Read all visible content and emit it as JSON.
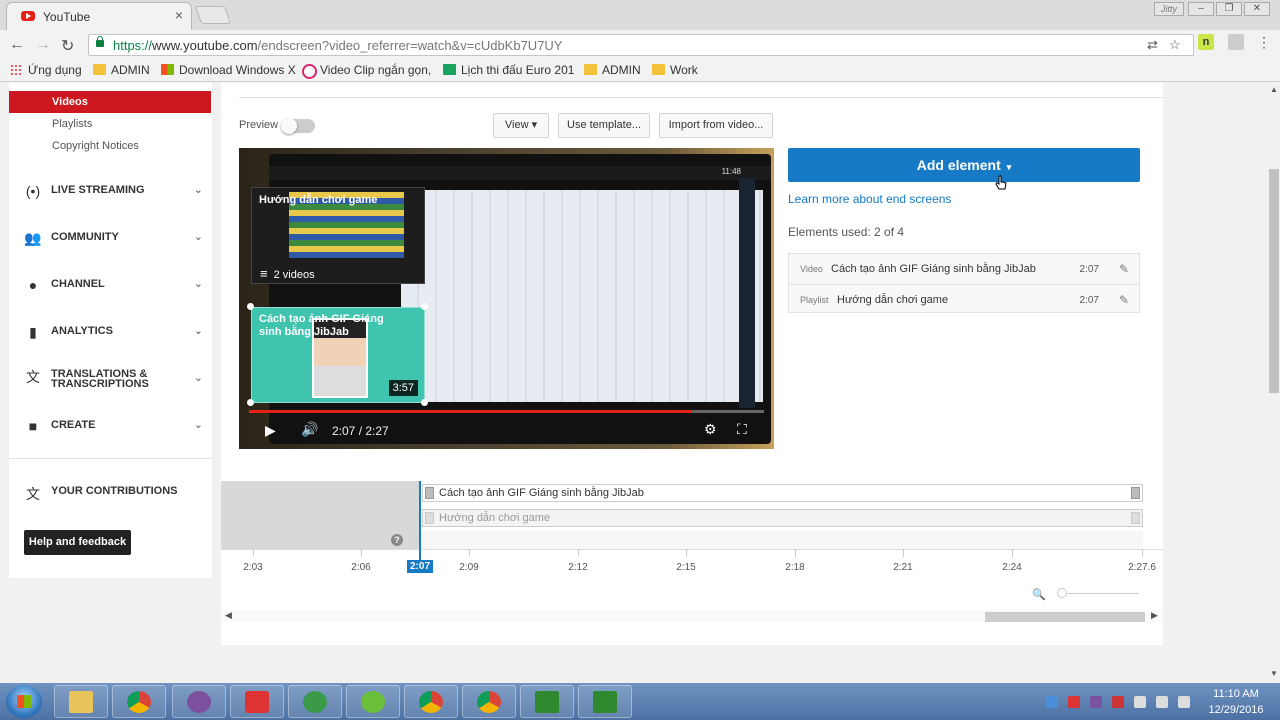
{
  "browser": {
    "tab_title": "YouTube",
    "tab_close": "×",
    "url_https": "https://",
    "url_host": "www.youtube.com",
    "url_path": "/endscreen?video_referrer=watch&v=cUdbKb7U7UY",
    "user_label": "Jitty",
    "window_controls": [
      "–",
      "❐",
      "✕"
    ],
    "bookmarks": [
      "Ứng dụng",
      "ADMIN",
      "Download Windows X",
      "Video Clip ngắn gọn,",
      "Lịch thi đấu Euro 201",
      "ADMIN",
      "Work"
    ]
  },
  "sidebar": {
    "active": "Videos",
    "subitems": [
      "Playlists",
      "Copyright Notices"
    ],
    "sections": [
      {
        "label": "LIVE STREAMING",
        "icon": "broadcast-icon"
      },
      {
        "label": "COMMUNITY",
        "icon": "people-icon"
      },
      {
        "label": "CHANNEL",
        "icon": "person-icon"
      },
      {
        "label": "ANALYTICS",
        "icon": "bar-chart-icon"
      },
      {
        "label": "TRANSLATIONS & TRANSCRIPTIONS",
        "icon": "translate-icon"
      },
      {
        "label": "CREATE",
        "icon": "camera-icon"
      }
    ],
    "contributions": "YOUR CONTRIBUTIONS",
    "help": "Help and feedback"
  },
  "editor": {
    "preview_label": "Preview",
    "view_button": "View",
    "template_button": "Use template...",
    "import_button": "Import from video...",
    "player_time_readout": "2:07 / 2:27",
    "progress_fraction": 0.86,
    "phone_time": "11:48",
    "card_playlist_title": "Hướng dẫn chơi game",
    "card_playlist_count": "2 videos",
    "card_video_title": "Cách tạo ảnh GIF Giáng sinh bằng JibJab",
    "card_video_duration": "3:57",
    "add_element": "Add element",
    "learn_more": "Learn more about end screens",
    "elements_used": "Elements used: 2 of 4",
    "elements": [
      {
        "type": "Video",
        "name": "Cách tạo ảnh GIF Giáng sinh bằng JibJab",
        "time": "2:07"
      },
      {
        "type": "Playlist",
        "name": "Hướng dẫn chơi game",
        "time": "2:07"
      }
    ]
  },
  "timeline": {
    "tracks": [
      "Cách tạo ảnh GIF Giáng sinh bằng JibJab",
      "Hướng dẫn chơi game"
    ],
    "labels": [
      "2:03",
      "2:06",
      "2:07",
      "2:09",
      "2:12",
      "2:15",
      "2:18",
      "2:21",
      "2:24",
      "2:27.6"
    ],
    "current": "2:07"
  },
  "taskbar": {
    "time": "11:10 AM",
    "date": "12/29/2016"
  },
  "colors": {
    "accent_blue": "#167ac6",
    "youtube_red": "#cc181e",
    "progress_red": "#e62117"
  }
}
